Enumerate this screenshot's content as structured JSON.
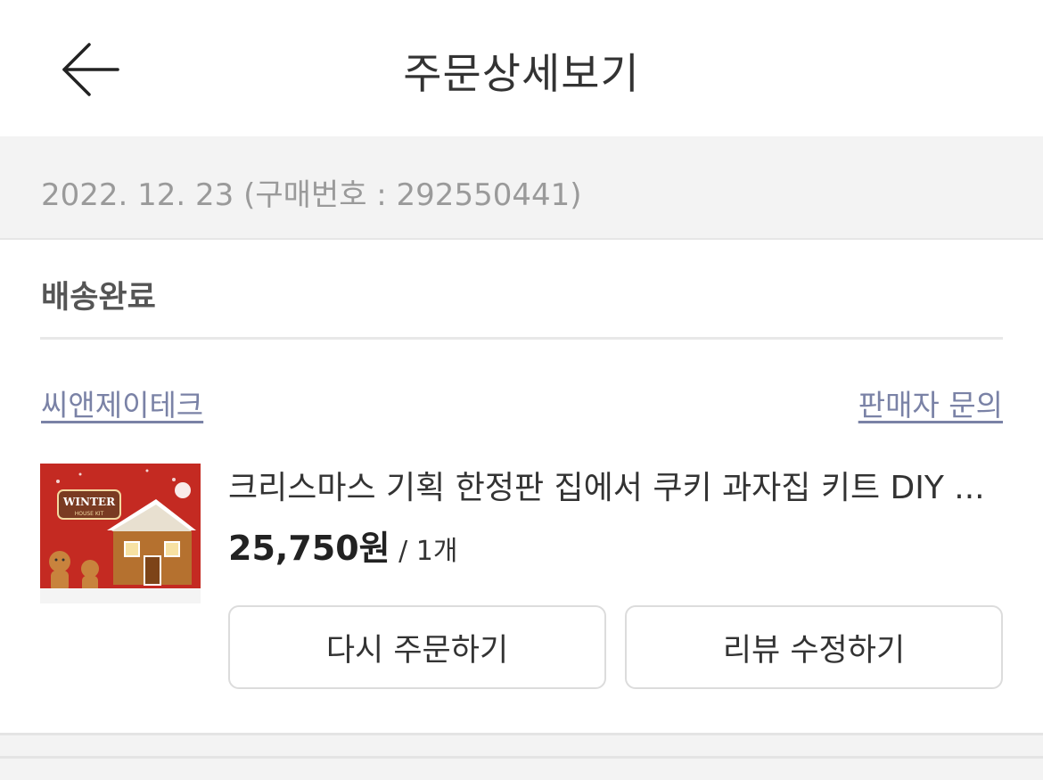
{
  "header": {
    "back_icon": "arrow-left-icon",
    "title": "주문상세보기"
  },
  "order": {
    "meta": "2022. 12. 23 (구매번호 : 292550441)",
    "status": "배송완료"
  },
  "seller": {
    "name": "씨앤제이테크",
    "inquiry_label": "판매자 문의"
  },
  "product": {
    "name": "크리스마스 기획 한정판 집에서 쿠키 과자집 키트 DIY ...",
    "price": "25,750원",
    "quantity": " / 1개",
    "thumbnail_icon": "gingerbread-house-kit-image",
    "thumbnail_text": "WINTER",
    "thumbnail_subtext": "HOUSE KIT"
  },
  "actions": {
    "reorder_label": "다시 주문하기",
    "edit_review_label": "리뷰 수정하기"
  },
  "colors": {
    "link": "#7a82a6",
    "meta_text": "#9a9a9a",
    "band_bg": "#f3f3f3"
  }
}
